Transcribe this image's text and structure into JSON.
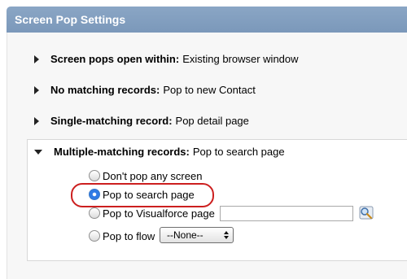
{
  "header": {
    "title": "Screen Pop Settings"
  },
  "settings": [
    {
      "label": "Screen pops open within:",
      "value": "Existing browser window"
    },
    {
      "label": "No matching records:",
      "value": "Pop to new Contact"
    },
    {
      "label": "Single-matching record:",
      "value": "Pop detail page"
    },
    {
      "label": "Multiple-matching records:",
      "value": "Pop to search page"
    }
  ],
  "multiple_options": [
    {
      "label": "Don't pop any screen",
      "selected": false
    },
    {
      "label": "Pop to search page",
      "selected": true
    },
    {
      "label": "Pop to Visualforce page",
      "selected": false
    },
    {
      "label": "Pop to flow",
      "selected": false
    }
  ],
  "visualforce_input": {
    "value": ""
  },
  "flow_select": {
    "selected": "--None--"
  },
  "colors": {
    "header": "#7b98ba",
    "highlight": "#cc1f1f",
    "selected_radio": "#2f7ae5"
  }
}
